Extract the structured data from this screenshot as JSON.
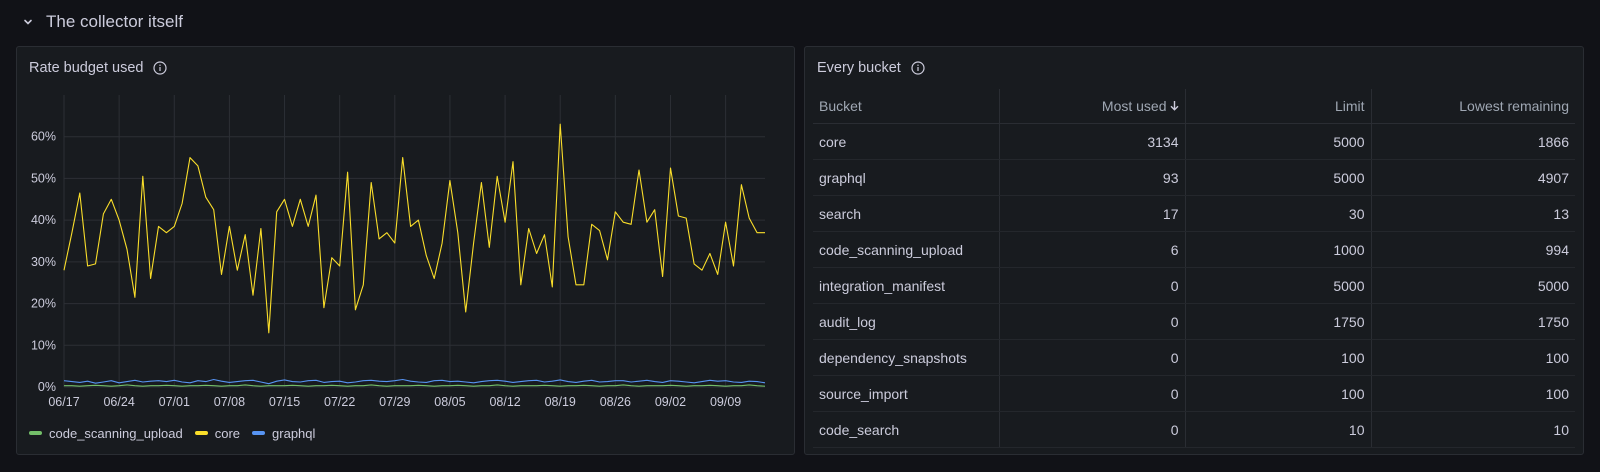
{
  "row": {
    "title": "The collector itself"
  },
  "chart_panel": {
    "title": "Rate budget used",
    "legend": [
      {
        "name": "code_scanning_upload",
        "color": "#73bf69"
      },
      {
        "name": "core",
        "color": "#fade2a"
      },
      {
        "name": "graphql",
        "color": "#5794f2"
      }
    ]
  },
  "chart_data": {
    "type": "line",
    "x_ticks": [
      "06/17",
      "06/24",
      "07/01",
      "07/08",
      "07/15",
      "07/22",
      "07/29",
      "08/05",
      "08/12",
      "08/19",
      "08/26",
      "09/02",
      "09/09"
    ],
    "y_ticks": [
      "0%",
      "10%",
      "20%",
      "30%",
      "40%",
      "50%",
      "60%"
    ],
    "ylim": [
      0,
      70
    ],
    "grid": true,
    "legend_placement": "bottom-left",
    "series": [
      {
        "name": "core",
        "color": "#fade2a",
        "values": [
          28,
          37,
          46.5,
          29,
          29.5,
          41.5,
          45,
          40,
          33,
          21.5,
          50.5,
          26,
          38.5,
          37,
          38.5,
          44,
          55,
          53,
          45.5,
          42.5,
          27,
          38.5,
          28,
          36.5,
          22,
          38,
          13,
          42,
          45,
          38.5,
          45,
          38.5,
          46,
          19,
          31,
          29,
          51.5,
          18.5,
          24.5,
          49,
          35.5,
          37,
          34.5,
          55,
          38.5,
          40,
          31.5,
          26,
          34.5,
          49.5,
          37,
          18,
          34.5,
          49,
          33.5,
          50.5,
          39.5,
          54,
          24.5,
          38,
          32,
          36.5,
          24,
          63,
          36,
          24.5,
          24.5,
          39,
          37.5,
          30.5,
          42,
          39.5,
          39,
          52,
          39.5,
          42.5,
          26.5,
          52.5,
          41,
          40.5,
          29.5,
          28,
          32,
          27,
          39.5,
          29,
          48.5,
          40.5,
          37,
          37
        ]
      },
      {
        "name": "graphql",
        "color": "#5794f2",
        "values": [
          1.5,
          1.3,
          1.1,
          1.4,
          0.9,
          1.2,
          1.5,
          1.0,
          1.3,
          1.6,
          1.2,
          1.4,
          1.5,
          1.3,
          1.6,
          1.2,
          1.0,
          1.5,
          1.3,
          1.8,
          1.4,
          1.1,
          1.3,
          1.5,
          1.6,
          1.2,
          0.8,
          1.4,
          1.7,
          1.3,
          1.2,
          1.5,
          1.6,
          1.1,
          1.3,
          1.4,
          1.0,
          1.2,
          1.5,
          1.6,
          1.4,
          1.3,
          1.5,
          1.8,
          1.4,
          1.2,
          1.1,
          1.5,
          1.6,
          1.3,
          1.4,
          1.2,
          1.0,
          1.3,
          1.5,
          1.6,
          1.4,
          1.1,
          1.3,
          1.5,
          1.6,
          1.2,
          1.4,
          1.7,
          1.3,
          1.1,
          1.4,
          1.6,
          1.2,
          1.3,
          1.5,
          1.5,
          1.2,
          1.4,
          1.6,
          1.3,
          1.1,
          1.5,
          1.4,
          1.2,
          1.0,
          1.3,
          1.6,
          1.4,
          1.5,
          1.2,
          1.1,
          1.4,
          1.3,
          1.0
        ]
      },
      {
        "name": "code_scanning_upload",
        "color": "#73bf69",
        "values": [
          0.3,
          0.3,
          0.2,
          0.3,
          0.4,
          0.3,
          0.2,
          0.3,
          0.5,
          0.3,
          0.2,
          0.3,
          0.3,
          0.4,
          0.3,
          0.2,
          0.3,
          0.3,
          0.4,
          0.3,
          0.2,
          0.3,
          0.3,
          0.5,
          0.3,
          0.2,
          0.3,
          0.3,
          0.3,
          0.4,
          0.3,
          0.2,
          0.3,
          0.3,
          0.4,
          0.3,
          0.2,
          0.3,
          0.3,
          0.5,
          0.3,
          0.2,
          0.3,
          0.3,
          0.3,
          0.4,
          0.3,
          0.2,
          0.3,
          0.3,
          0.4,
          0.3,
          0.2,
          0.3,
          0.3,
          0.5,
          0.3,
          0.2,
          0.3,
          0.3,
          0.3,
          0.4,
          0.3,
          0.2,
          0.3,
          0.3,
          0.4,
          0.3,
          0.2,
          0.3,
          0.3,
          0.5,
          0.3,
          0.2,
          0.3,
          0.3,
          0.3,
          0.4,
          0.3,
          0.2,
          0.3,
          0.3,
          0.4,
          0.3,
          0.2,
          0.3,
          0.3,
          0.5,
          0.3,
          0.2
        ]
      }
    ]
  },
  "table_panel": {
    "title": "Every bucket",
    "columns": [
      "Bucket",
      "Most used",
      "Limit",
      "Lowest remaining"
    ],
    "sort_indicator": "arrow-down-icon",
    "rows": [
      [
        "core",
        "3134",
        "5000",
        "1866"
      ],
      [
        "graphql",
        "93",
        "5000",
        "4907"
      ],
      [
        "search",
        "17",
        "30",
        "13"
      ],
      [
        "code_scanning_upload",
        "6",
        "1000",
        "994"
      ],
      [
        "integration_manifest",
        "0",
        "5000",
        "5000"
      ],
      [
        "audit_log",
        "0",
        "1750",
        "1750"
      ],
      [
        "dependency_snapshots",
        "0",
        "100",
        "100"
      ],
      [
        "source_import",
        "0",
        "100",
        "100"
      ],
      [
        "code_search",
        "0",
        "10",
        "10"
      ]
    ]
  }
}
